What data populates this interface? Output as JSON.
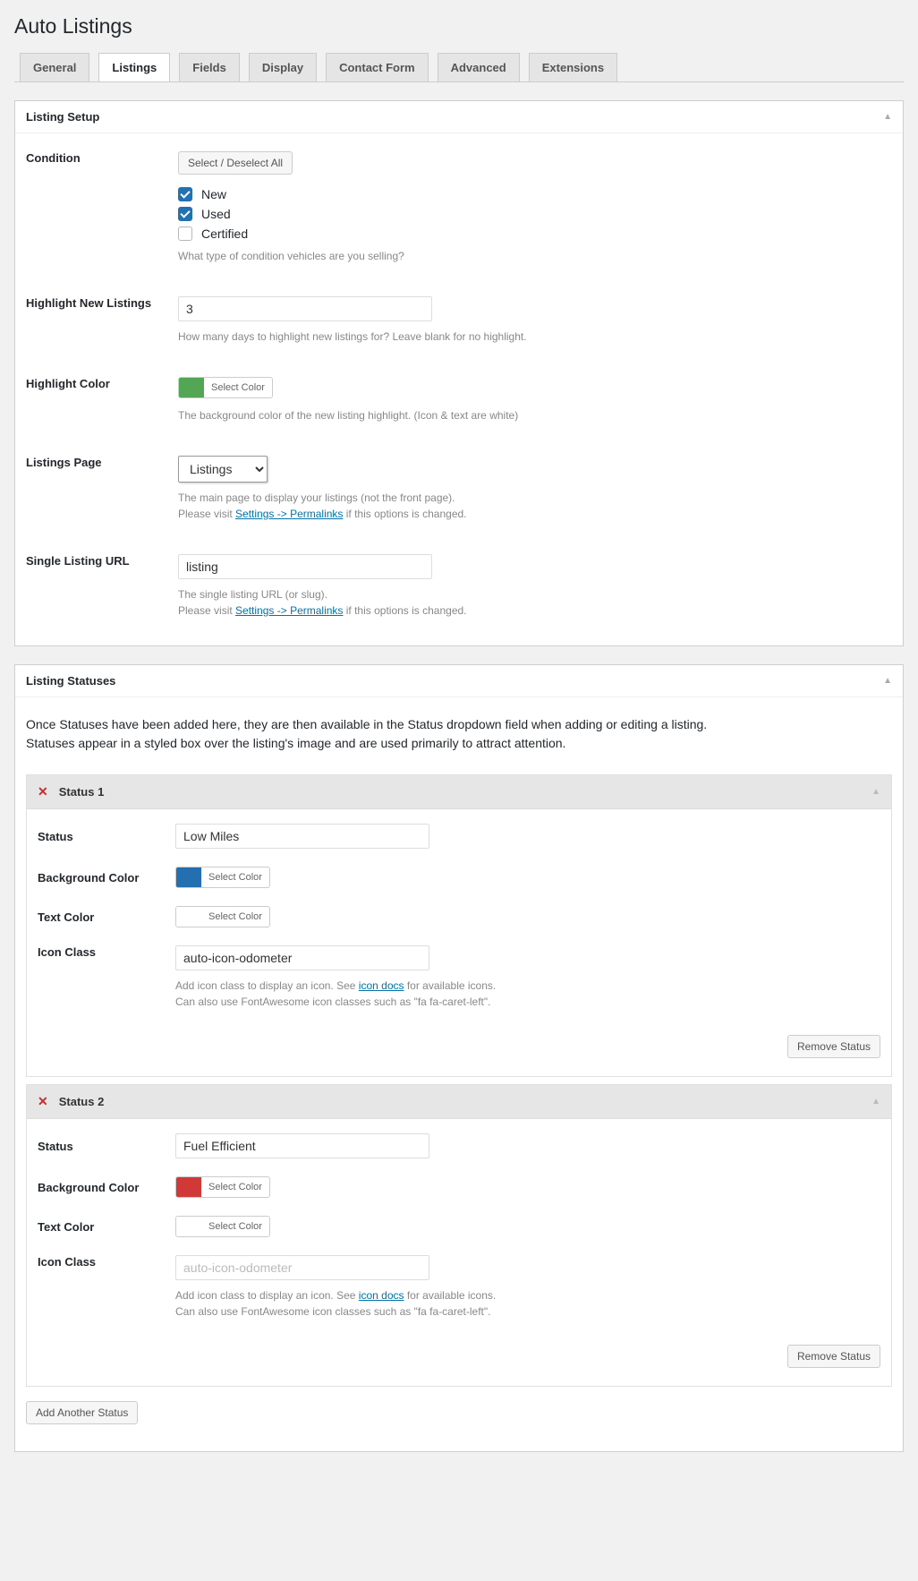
{
  "page_title": "Auto Listings",
  "tabs": {
    "general": "General",
    "listings": "Listings",
    "fields": "Fields",
    "display": "Display",
    "contact_form": "Contact Form",
    "advanced": "Advanced",
    "extensions": "Extensions"
  },
  "panel1": {
    "title": "Listing Setup",
    "condition": {
      "label": "Condition",
      "select_all_btn": "Select / Deselect All",
      "options": {
        "new": "New",
        "used": "Used",
        "certified": "Certified"
      },
      "desc": "What type of condition vehicles are you selling?"
    },
    "highlight_new": {
      "label": "Highlight New Listings",
      "value": "3",
      "desc": "How many days to highlight new listings for? Leave blank for no highlight."
    },
    "highlight_color": {
      "label": "Highlight Color",
      "btn": "Select Color",
      "desc": "The background color of the new listing highlight. (Icon & text are white)"
    },
    "listings_page": {
      "label": "Listings Page",
      "value": "Listings",
      "desc1": "The main page to display your listings (not the front page).",
      "desc2a": "Please visit ",
      "desc2link": "Settings -> Permalinks",
      "desc2b": " if this options is changed."
    },
    "single_url": {
      "label": "Single Listing URL",
      "value": "listing",
      "desc1": "The single listing URL (or slug).",
      "desc2a": "Please visit ",
      "desc2link": "Settings -> Permalinks",
      "desc2b": " if this options is changed."
    }
  },
  "panel2": {
    "title": "Listing Statuses",
    "intro1": "Once Statuses have been added here, they are then available in the Status dropdown field when adding or editing a listing.",
    "intro2": "Statuses appear in a styled box over the listing's image and are used primarily to attract attention.",
    "labels": {
      "status": "Status",
      "bg_color": "Background Color",
      "text_color": "Text Color",
      "icon_class": "Icon Class",
      "select_color": "Select Color"
    },
    "icon_desc1a": "Add icon class to display an icon. See ",
    "icon_desc1link": "icon docs",
    "icon_desc1b": " for available icons.",
    "icon_desc2": "Can also use FontAwesome icon classes such as \"fa fa-caret-left\".",
    "remove_btn": "Remove Status",
    "add_btn": "Add Another Status",
    "statuses": [
      {
        "title": "Status 1",
        "status_value": "Low Miles",
        "icon_value": "auto-icon-odometer",
        "icon_placeholder": "",
        "bg": "blue"
      },
      {
        "title": "Status 2",
        "status_value": "Fuel Efficient",
        "icon_value": "",
        "icon_placeholder": "auto-icon-odometer",
        "bg": "red"
      }
    ]
  }
}
